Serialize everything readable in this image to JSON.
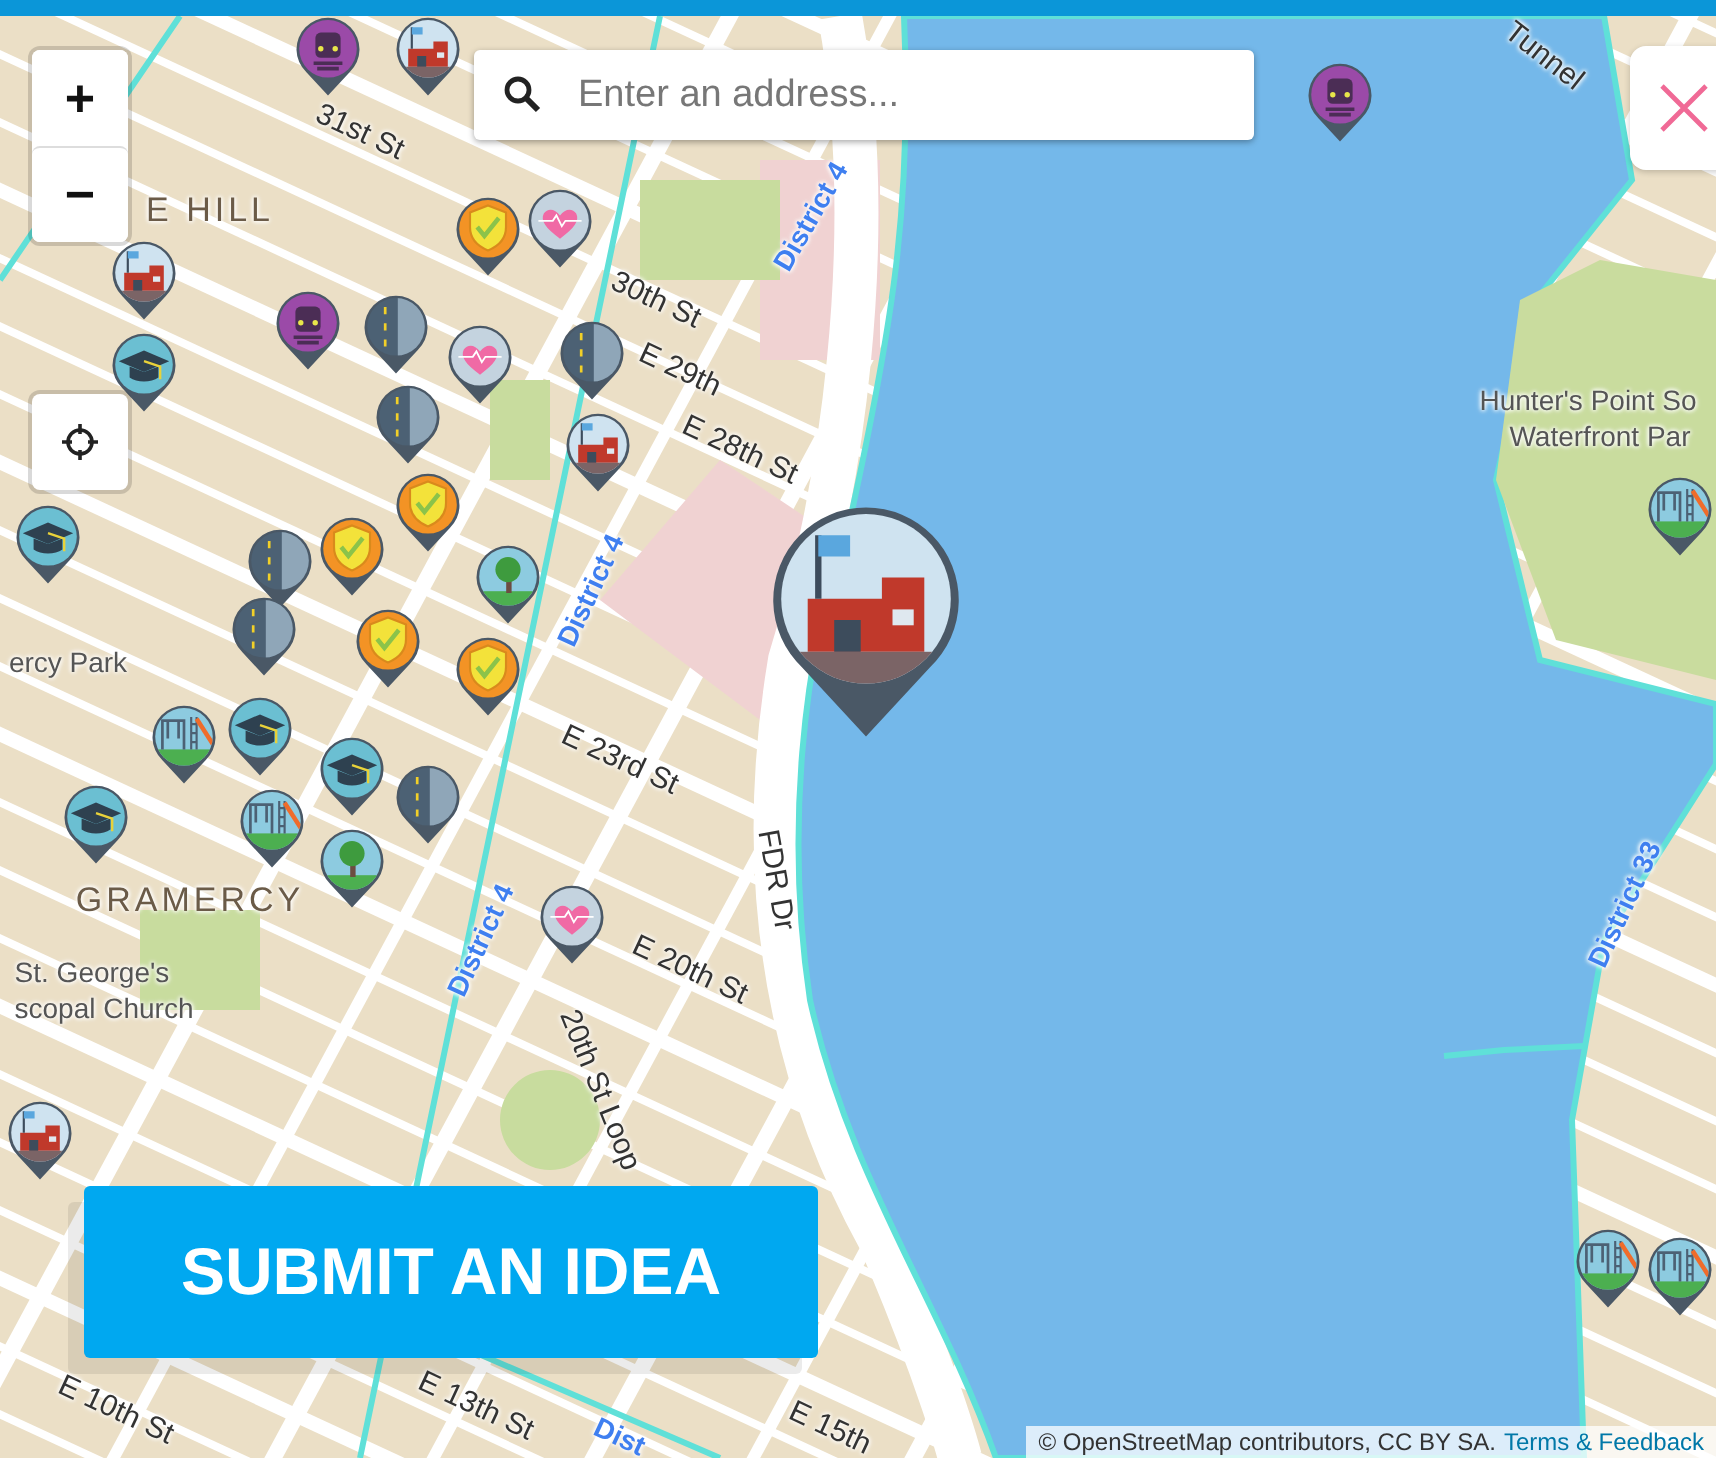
{
  "search": {
    "placeholder": "Enter an address..."
  },
  "zoom": {
    "in": "+",
    "out": "−"
  },
  "submit_button": {
    "label": "SUBMIT AN IDEA"
  },
  "attribution": {
    "text": "© OpenStreetMap contributors, CC BY SA.",
    "link": "Terms & Feedback"
  },
  "map_labels": [
    {
      "kind": "street",
      "text": "31st St"
    },
    {
      "kind": "street",
      "text": "30th St"
    },
    {
      "kind": "street",
      "text": "E 29th"
    },
    {
      "kind": "street",
      "text": "E 28th St"
    },
    {
      "kind": "street",
      "text": "E 23rd St"
    },
    {
      "kind": "street",
      "text": "E 20th St"
    },
    {
      "kind": "street",
      "text": "20th St Loop"
    },
    {
      "kind": "street",
      "text": "FDR Dr"
    },
    {
      "kind": "street",
      "text": "E 13th St"
    },
    {
      "kind": "street",
      "text": "E 10th St"
    },
    {
      "kind": "street",
      "text": "E 15th"
    },
    {
      "kind": "street",
      "text": "Tunnel"
    },
    {
      "kind": "district",
      "text": "District 4"
    },
    {
      "kind": "district",
      "text": "District 4"
    },
    {
      "kind": "district",
      "text": "District 4"
    },
    {
      "kind": "district",
      "text": "District 33"
    },
    {
      "kind": "district",
      "text": "Dist"
    },
    {
      "kind": "area",
      "text": "E HILL"
    },
    {
      "kind": "area",
      "text": "GRAMERCY"
    },
    {
      "kind": "place",
      "text": "ercy Park"
    },
    {
      "kind": "place",
      "text": "St. George's"
    },
    {
      "kind": "place",
      "text": "scopal Church"
    },
    {
      "kind": "place",
      "text": "Hunter's Point So"
    },
    {
      "kind": "place",
      "text": "Waterfront Par"
    }
  ],
  "pins": [
    {
      "kind": "transit",
      "selected": false
    },
    {
      "kind": "government",
      "selected": false
    },
    {
      "kind": "police",
      "selected": false
    },
    {
      "kind": "hospital",
      "selected": false
    },
    {
      "kind": "road",
      "selected": false
    },
    {
      "kind": "government",
      "selected": false
    },
    {
      "kind": "school",
      "selected": false
    },
    {
      "kind": "transit",
      "selected": false
    },
    {
      "kind": "road",
      "selected": false
    },
    {
      "kind": "hospital",
      "selected": false
    },
    {
      "kind": "road",
      "selected": false
    },
    {
      "kind": "road",
      "selected": false
    },
    {
      "kind": "government",
      "selected": false
    },
    {
      "kind": "police",
      "selected": false
    },
    {
      "kind": "police",
      "selected": false
    },
    {
      "kind": "road",
      "selected": false
    },
    {
      "kind": "police",
      "selected": false
    },
    {
      "kind": "park",
      "selected": false
    },
    {
      "kind": "police",
      "selected": false
    },
    {
      "kind": "school",
      "selected": false
    },
    {
      "kind": "transit",
      "selected": false
    },
    {
      "kind": "school",
      "selected": false
    },
    {
      "kind": "playground",
      "selected": false
    },
    {
      "kind": "school",
      "selected": false
    },
    {
      "kind": "playground",
      "selected": false
    },
    {
      "kind": "school",
      "selected": false
    },
    {
      "kind": "park",
      "selected": false
    },
    {
      "kind": "road",
      "selected": false
    },
    {
      "kind": "hospital",
      "selected": false
    },
    {
      "kind": "government",
      "selected": false
    },
    {
      "kind": "playground",
      "selected": false
    },
    {
      "kind": "playground",
      "selected": false
    },
    {
      "kind": "playground",
      "selected": false
    },
    {
      "kind": "government",
      "selected": true
    }
  ]
}
